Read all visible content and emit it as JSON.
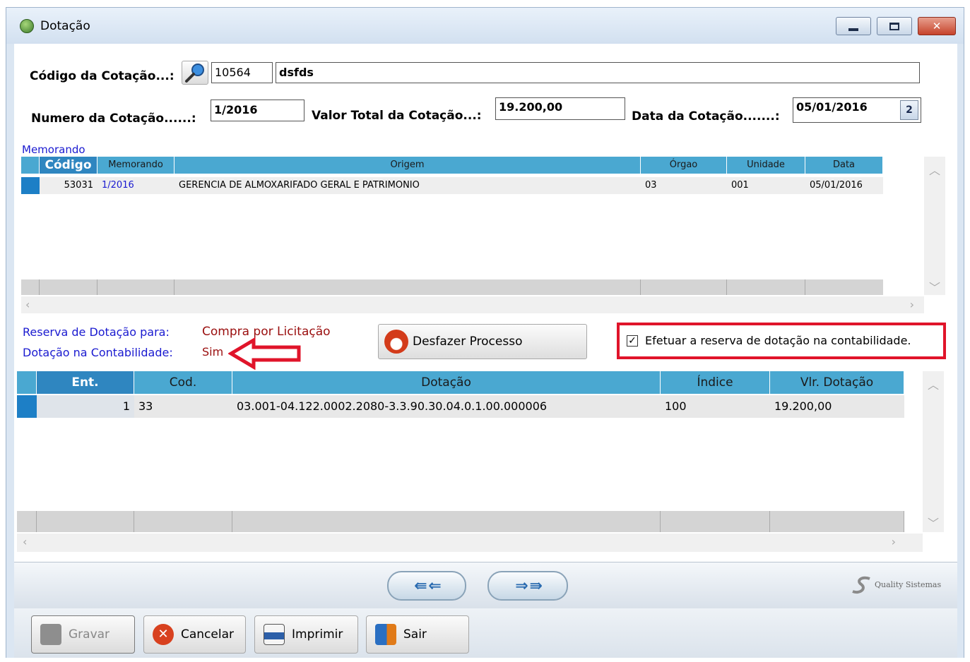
{
  "window": {
    "title": "Dotação"
  },
  "form": {
    "codigo_label": "Código da Cotação...:",
    "codigo_value": "10564",
    "descricao_value": "dsfds",
    "numero_label": "Numero da Cotação......:",
    "numero_value": "1/2016",
    "valor_label": "Valor Total da Cotação...:",
    "valor_value": "19.200,00",
    "data_label": "Data da Cotação.......:",
    "data_value": "05/01/2016",
    "calendar_glyph": "2"
  },
  "memorando": {
    "section_title": "Memorando",
    "columns": [
      "Código",
      "Memorando",
      "Origem",
      "Órgao",
      "Unidade",
      "Data"
    ],
    "rows": [
      {
        "codigo": "53031",
        "memorando": "1/2016",
        "origem": "GERENCIA DE ALMOXARIFADO GERAL E PATRIMONIO",
        "orgao": "03",
        "unidade": "001",
        "data": "05/01/2016"
      }
    ]
  },
  "reserva": {
    "reserva_label": "Reserva de Dotação para:",
    "reserva_value": "Compra por Licitação",
    "contab_label": "Dotação na Contabilidade:",
    "contab_value": "Sim",
    "desfazer_label": "Desfazer Processo",
    "checkbox_label": "Efetuar a reserva de dotação na contabilidade.",
    "checkbox_mark": "✓"
  },
  "dotacao": {
    "columns": [
      "Ent.",
      "Cod.",
      "Dotação",
      "Índice",
      "Vlr. Dotação"
    ],
    "rows": [
      {
        "ent": "1",
        "cod": "33",
        "dotacao": "03.001-04.122.0002.2080-3.3.90.30.04.0.1.00.000006",
        "indice": "100",
        "valor": "19.200,00"
      }
    ]
  },
  "nav": {
    "first_prev": "⇚ ⇐",
    "next_last": "⇒ ⇛"
  },
  "brand": "Quality Sistemas",
  "footer": {
    "gravar": "Gravar",
    "cancelar": "Cancelar",
    "imprimir": "Imprimir",
    "sair": "Sair"
  },
  "colors": {
    "grid_header": "#4aa8d1",
    "highlight": "#e0142a",
    "label_blue": "#1a1ad0",
    "value_red": "#9a0e0e"
  }
}
